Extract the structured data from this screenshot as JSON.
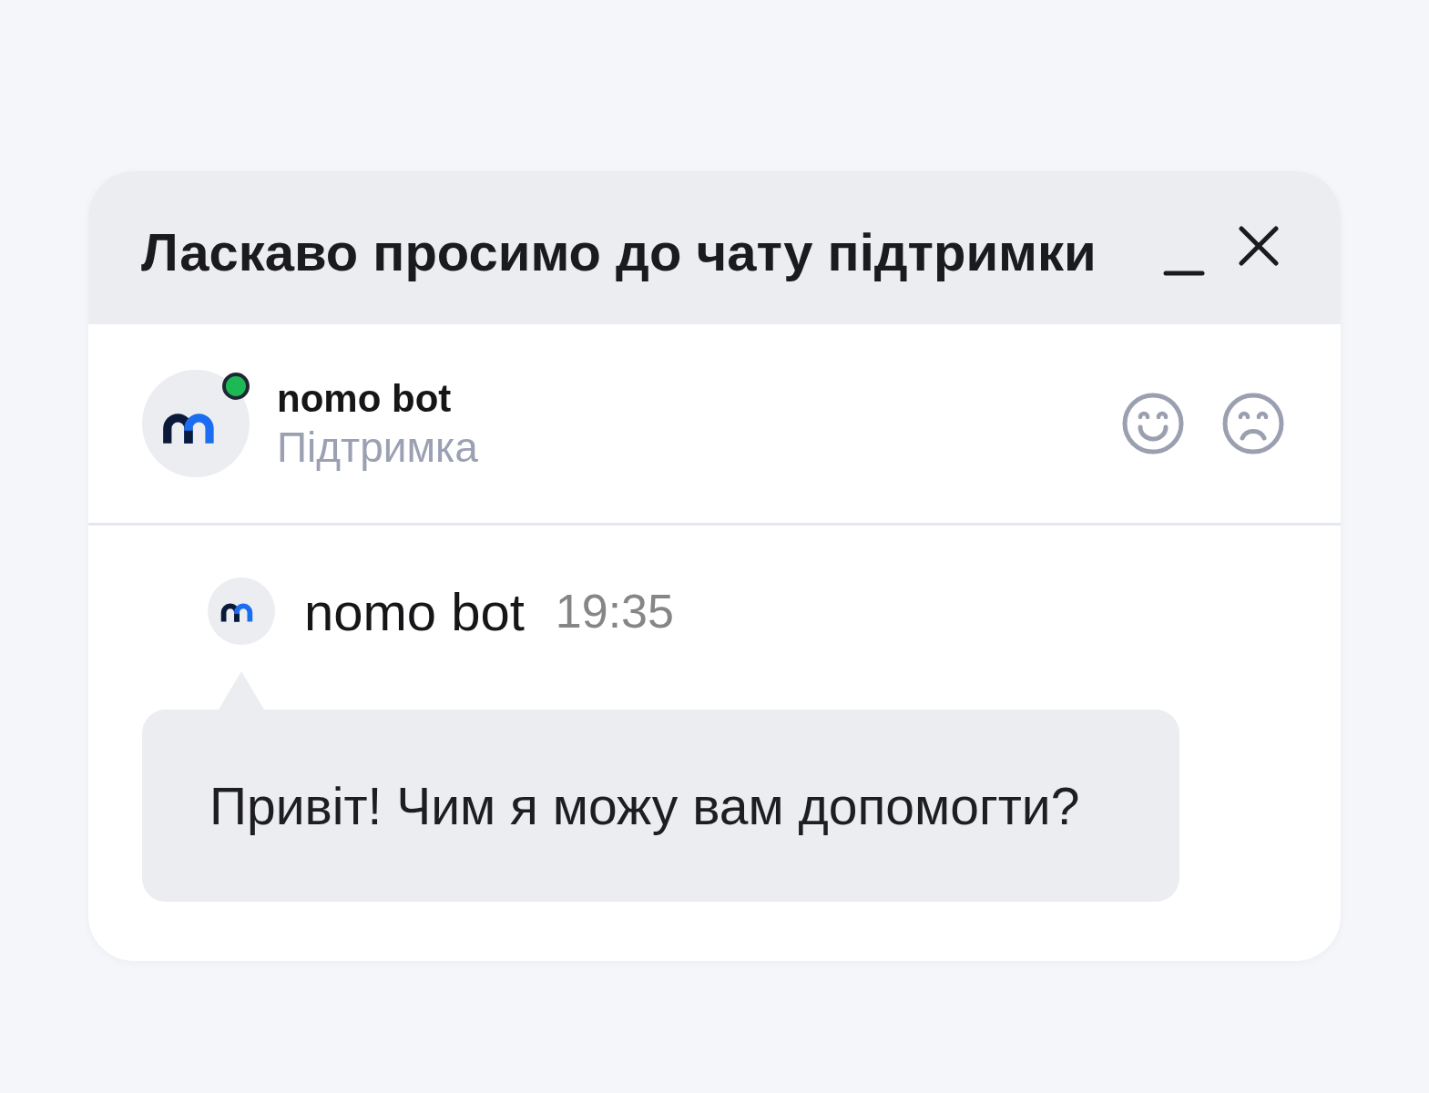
{
  "header": {
    "title": "Ласкаво просимо до чату підтримки"
  },
  "agent": {
    "name": "nomo bot",
    "role": "Підтримка",
    "online": true
  },
  "messages": [
    {
      "sender": "nomo bot",
      "time": "19:35",
      "text": "Привіт! Чим я можу вам допомогти?"
    }
  ]
}
